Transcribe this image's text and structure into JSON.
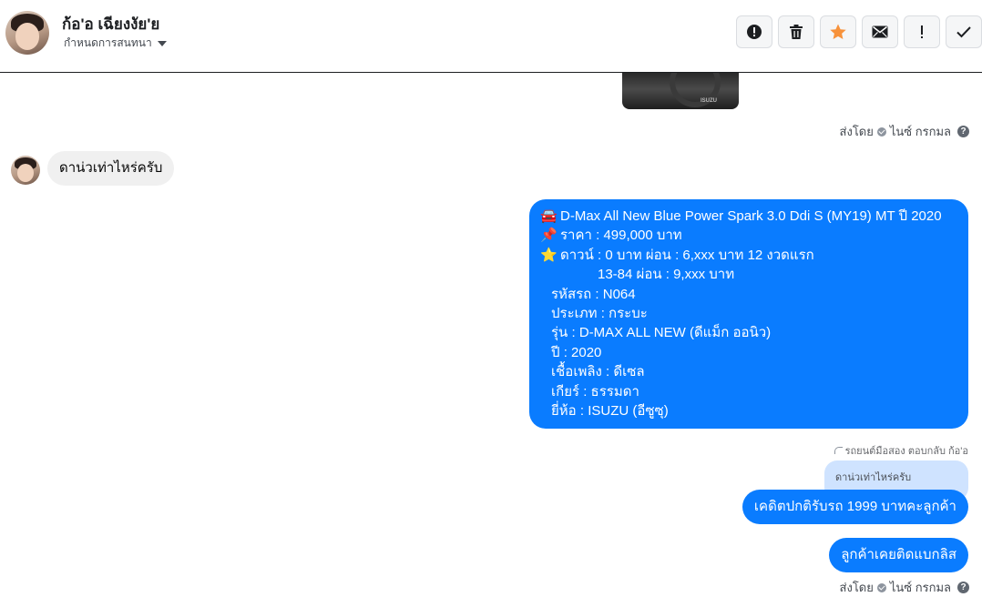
{
  "header": {
    "contact_name": "ก้อ'อ เฉียงงัย'ย",
    "assign_label": "กำหนดการสนทนา"
  },
  "toolbar": [
    {
      "name": "report-icon",
      "label": "report"
    },
    {
      "name": "trash-icon",
      "label": "delete"
    },
    {
      "name": "star-icon",
      "label": "star",
      "color": "#f7923b"
    },
    {
      "name": "mail-icon",
      "label": "mark unread"
    },
    {
      "name": "exclamation-icon",
      "label": "follow up"
    },
    {
      "name": "checkmark-icon",
      "label": "done"
    }
  ],
  "messages": {
    "sent_by_top": {
      "prefix": "ส่งโดย",
      "agent": "ไนซ์ กรกมล"
    },
    "incoming": {
      "text": "ดาน่วเท่าไหร่ครับ"
    },
    "card": {
      "lines": [
        {
          "emoji": "🚘",
          "text": "D-Max All New Blue Power Spark 3.0 Ddi S (MY19) MT ปี 2020"
        },
        {
          "emoji": "📌",
          "text": "ราคา : 499,000 บาท"
        },
        {
          "emoji": "⭐",
          "text": "ดาวน์ : 0 บาท ผ่อน : 6,xxx บาท 12 งวดแรก"
        },
        {
          "text": "13-84 ผ่อน : 9,xxx บาท"
        },
        {
          "text": "รหัสรถ : N064"
        },
        {
          "text": "ประเภท : กระบะ"
        },
        {
          "text": "รุ่น : D-MAX ALL NEW (ดีแม็ก ออนิว)"
        },
        {
          "text": "ปี : 2020"
        },
        {
          "text": "เชื้อเพลิง : ดีเซล"
        },
        {
          "text": "เกียร์ : ธรรมดา"
        },
        {
          "text": "ยี่ห้อ : ISUZU (อีซูซุ)"
        }
      ]
    },
    "reply_meta": "รถยนต์มือสอง ตอบกลับ ก้อ'อ",
    "quoted_text": "ดาน่วเท่าไหร่ครับ",
    "outgoing_1": "เคดิตปกติรับรถ 1999 บาทคะลูกค้า",
    "outgoing_2": "ลูกค้าเคยติดแบกลิส",
    "sent_by_bottom": {
      "prefix": "ส่งโดย",
      "agent": "ไนซ์ กรกมล"
    }
  },
  "colors": {
    "accent_blue": "#0a7cff",
    "incoming_bg": "#f0f0f0",
    "quoted_bg": "#cfe3ff",
    "star": "#f7923b"
  }
}
